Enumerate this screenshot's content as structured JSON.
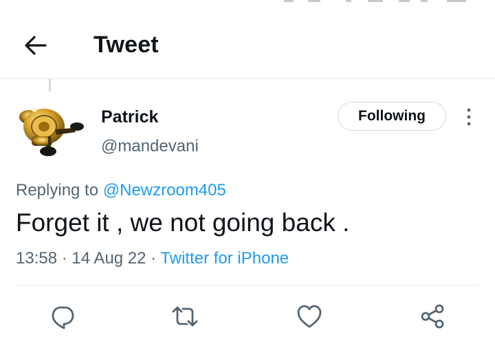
{
  "header": {
    "title": "Tweet",
    "back_icon": "arrow-left-icon"
  },
  "tweet": {
    "author": {
      "display_name": "Patrick",
      "handle": "@mandevani",
      "avatar": "fishing-reel-avatar"
    },
    "follow_label": "Following",
    "more_icon": "more-vertical-icon",
    "replying_prefix": "Replying to ",
    "replying_to": "@Newzroom405",
    "text": "Forget it , we not going back .",
    "time": "13:58",
    "date": "14 Aug 22",
    "separator": " · ",
    "source": "Twitter for iPhone"
  },
  "actions": [
    {
      "name": "reply",
      "icon": "reply-icon"
    },
    {
      "name": "retweet",
      "icon": "retweet-icon"
    },
    {
      "name": "like",
      "icon": "heart-icon"
    },
    {
      "name": "share",
      "icon": "share-icon"
    }
  ],
  "colors": {
    "accent": "#1d9bf0",
    "secondary_text": "#536471",
    "primary_text": "#0f1419",
    "border": "#cfd9de"
  }
}
